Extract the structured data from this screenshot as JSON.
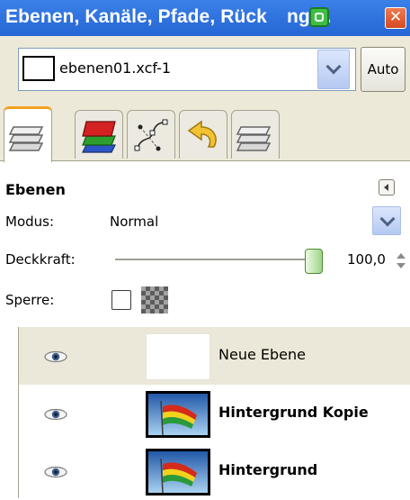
{
  "window": {
    "title": "Ebenen, Kanäle, Pfade, Rückgängi...",
    "title_part1": "Ebenen, Kanäle, Pfade, Rück",
    "title_part2": "ngi...",
    "close_label": "✕"
  },
  "image_selector": {
    "name": "ebenen01.xcf-1",
    "auto_label": "Auto"
  },
  "tabs": [
    {
      "name": "layers",
      "active": true
    },
    {
      "name": "channels",
      "active": false
    },
    {
      "name": "paths",
      "active": false
    },
    {
      "name": "undo-history",
      "active": false
    },
    {
      "name": "layers-extra",
      "active": false
    }
  ],
  "layers_panel": {
    "title": "Ebenen",
    "mode_label": "Modus:",
    "mode_value": "Normal",
    "opacity_label": "Deckkraft:",
    "opacity_value": "100,0",
    "opacity_fraction": 1.0,
    "lock_label": "Sperre:"
  },
  "layers": [
    {
      "name": "Neue Ebene",
      "visible": true,
      "selected": true,
      "thumb": "blank"
    },
    {
      "name": "Hintergrund Kopie",
      "visible": true,
      "selected": false,
      "thumb": "photo"
    },
    {
      "name": "Hintergrund",
      "visible": true,
      "selected": false,
      "thumb": "photo"
    }
  ],
  "colors": {
    "titlebar": "#2a6bd8",
    "selection": "#ece8d9",
    "tab_highlight": "#f2a21d"
  }
}
